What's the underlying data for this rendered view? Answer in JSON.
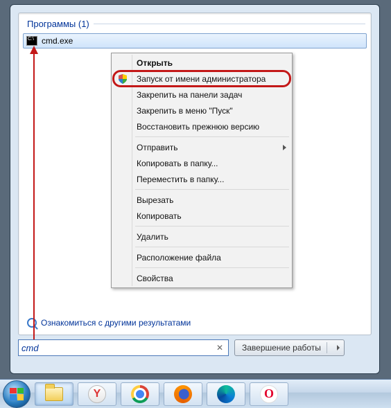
{
  "section": {
    "title": "Программы",
    "count": "(1)"
  },
  "result": {
    "filename": "cmd.exe"
  },
  "more_results_label": "Ознакомиться с другими результатами",
  "search": {
    "value": "cmd"
  },
  "shutdown_label": "Завершение работы",
  "context_menu": {
    "open": "Открыть",
    "run_as_admin": "Запуск от имени администратора",
    "pin_taskbar": "Закрепить на панели задач",
    "pin_start": "Закрепить в меню \"Пуск\"",
    "restore_prev": "Восстановить прежнюю версию",
    "send_to": "Отправить",
    "copy_to": "Копировать в папку...",
    "move_to": "Переместить в папку...",
    "cut": "Вырезать",
    "copy": "Копировать",
    "delete": "Удалить",
    "file_location": "Расположение файла",
    "properties": "Свойства"
  },
  "taskbar_icons": [
    "start",
    "explorer",
    "yandex",
    "chrome",
    "firefox",
    "edge",
    "opera"
  ]
}
